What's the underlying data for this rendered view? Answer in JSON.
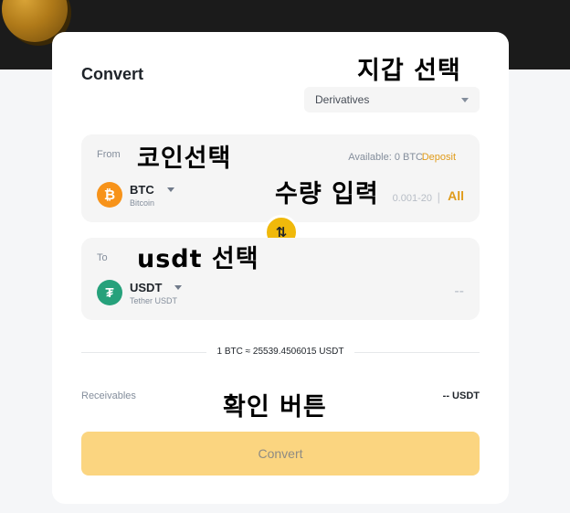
{
  "card": {
    "title": "Convert"
  },
  "wallet_select": {
    "value": "Derivatives"
  },
  "from": {
    "label": "From",
    "available": "Available: 0 BTC",
    "deposit": "Deposit",
    "coin": {
      "symbol": "BTC",
      "name": "Bitcoin",
      "icon": "₿"
    },
    "amount_placeholder": "0.001-20",
    "separator": "|",
    "all": "All"
  },
  "to": {
    "label": "To",
    "coin": {
      "symbol": "USDT",
      "name": "Tether USDT",
      "icon": "₮"
    },
    "amount": "--"
  },
  "swap": {
    "icon": "⇅"
  },
  "rate": "1 BTC ≈ 25539.4506015 USDT",
  "receivables": {
    "label": "Receivables",
    "value": "-- USDT"
  },
  "convert_button": "Convert",
  "annotations": {
    "wallet": "지갑 선택",
    "coin": "코인선택",
    "amount": "수량 입력",
    "usdt": "usdt 선택",
    "confirm": "확인 버튼"
  },
  "colors": {
    "accent": "#f0b90b",
    "link": "#e09b1a",
    "btc": "#f7931a",
    "usdt": "#26a17b",
    "button": "#fbd580"
  }
}
